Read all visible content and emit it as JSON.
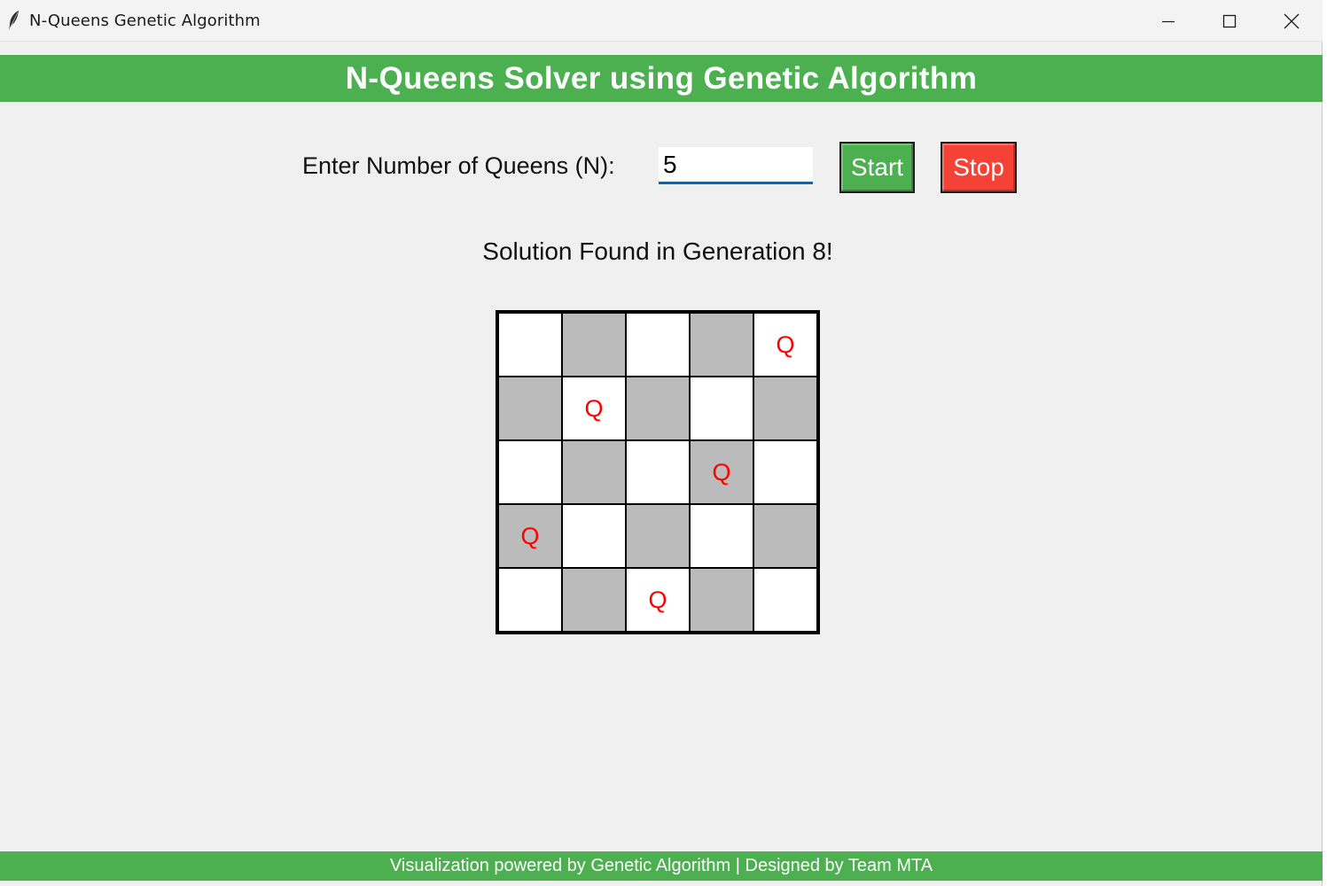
{
  "window": {
    "title": "N-Queens Genetic Algorithm",
    "icon": "feather-icon",
    "controls": [
      "minimize-icon",
      "maximize-icon",
      "close-icon"
    ]
  },
  "header": {
    "title": "N-Queens Solver using Genetic Algorithm"
  },
  "controls": {
    "n_label": "Enter Number of Queens (N):",
    "n_value": "5",
    "start_label": "Start",
    "stop_label": "Stop"
  },
  "status": {
    "text": "Solution Found in Generation 8!"
  },
  "board": {
    "size": 5,
    "queen_symbol": "Q",
    "queen_columns_by_row": [
      4,
      1,
      3,
      0,
      2
    ],
    "light_color": "#ffffff",
    "dark_color": "#bbbbbb",
    "queen_color": "#ff0000"
  },
  "footer": {
    "text": "Visualization powered by Genetic Algorithm | Designed by Team MTA"
  },
  "colors": {
    "accent_green": "#4caf50",
    "stop_red": "#f44336",
    "background": "#f0f0f0"
  }
}
